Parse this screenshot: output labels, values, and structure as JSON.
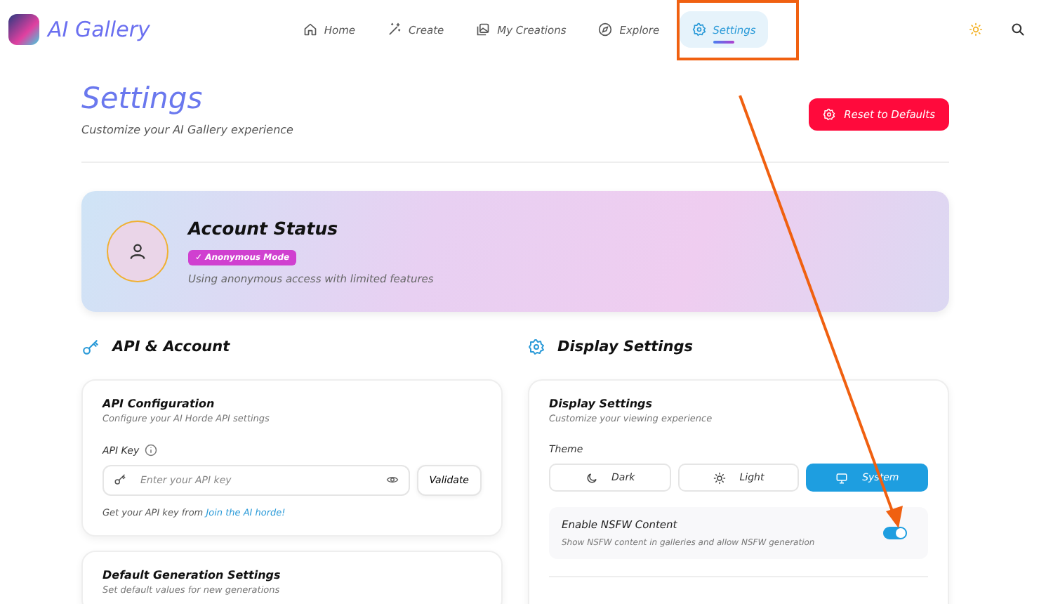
{
  "app": {
    "name": "AI Gallery"
  },
  "nav": [
    {
      "label": "Home",
      "selected": false
    },
    {
      "label": "Create",
      "selected": false
    },
    {
      "label": "My Creations",
      "selected": false
    },
    {
      "label": "Explore",
      "selected": false
    },
    {
      "label": "Settings",
      "selected": true
    }
  ],
  "page": {
    "title": "Settings",
    "subtitle": "Customize your AI Gallery experience",
    "reset_button": "Reset to Defaults"
  },
  "account": {
    "title": "Account Status",
    "badge": "✓ Anonymous Mode",
    "description": "Using anonymous access with limited features"
  },
  "api_section": {
    "heading": "API & Account",
    "api_card": {
      "title": "API Configuration",
      "subtitle": "Configure your AI Horde API settings",
      "field_label": "API Key",
      "placeholder": "Enter your API key",
      "validate_button": "Validate",
      "help_text": "Get your API key from",
      "help_link": "Join the AI horde!"
    },
    "defaults_card": {
      "title": "Default Generation Settings",
      "subtitle": "Set default values for new generations"
    }
  },
  "display_section": {
    "heading": "Display Settings",
    "card": {
      "title": "Display Settings",
      "subtitle": "Customize your viewing experience",
      "theme_label": "Theme",
      "themes": [
        {
          "label": "Dark",
          "selected": false
        },
        {
          "label": "Light",
          "selected": false
        },
        {
          "label": "System",
          "selected": true
        }
      ],
      "nsfw": {
        "title": "Enable NSFW Content",
        "description": "Show NSFW content in galleries and allow NSFW generation",
        "on": true
      }
    }
  }
}
